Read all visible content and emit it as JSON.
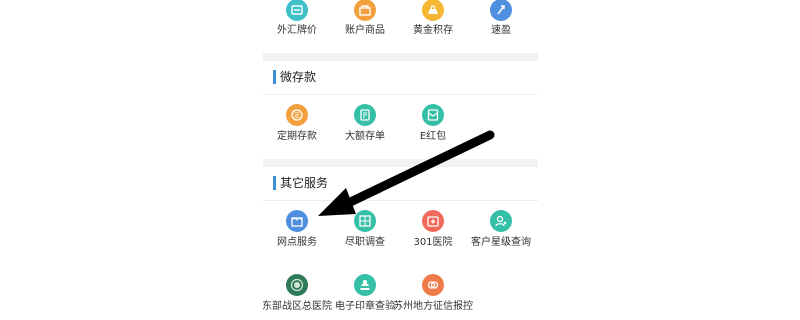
{
  "top_row": [
    {
      "label": "外汇牌价",
      "icon": "forex-rate-icon",
      "color": "#3fc1c9"
    },
    {
      "label": "账户商品",
      "icon": "account-goods-icon",
      "color": "#f2a03d"
    },
    {
      "label": "黄金积存",
      "icon": "gold-savings-icon",
      "color": "#f5b733"
    },
    {
      "label": "速盈",
      "icon": "quick-profit-icon",
      "color": "#4f8fe0"
    }
  ],
  "sections": [
    {
      "title": "微存款",
      "items": [
        {
          "label": "定期存款",
          "icon": "fixed-deposit-icon",
          "color": "#f2a03d",
          "glyph": "定"
        },
        {
          "label": "大额存单",
          "icon": "large-deposit-icon",
          "color": "#34bfa6",
          "glyph": "¥"
        },
        {
          "label": "E红包",
          "icon": "red-packet-icon",
          "color": "#34bfa6",
          "glyph": "✉"
        }
      ]
    },
    {
      "title": "其它服务",
      "items": [
        {
          "label": "网点服务",
          "icon": "branch-service-icon",
          "color": "#4f8fe0"
        },
        {
          "label": "尽职调查",
          "icon": "due-diligence-icon",
          "color": "#34bfa6"
        },
        {
          "label": "301医院",
          "icon": "hospital-icon",
          "color": "#f06a5b"
        },
        {
          "label": "客户星级查询",
          "icon": "customer-rating-icon",
          "color": "#34bfa6"
        },
        {
          "label": "东部战区总医院",
          "icon": "eastern-hospital-icon",
          "color": "#2f7a5a"
        },
        {
          "label": "电子印章查验",
          "icon": "e-seal-check-icon",
          "color": "#34bfa6"
        },
        {
          "label": "苏州地方征信报控",
          "icon": "suzhou-credit-icon",
          "color": "#f07b4a"
        }
      ]
    }
  ]
}
